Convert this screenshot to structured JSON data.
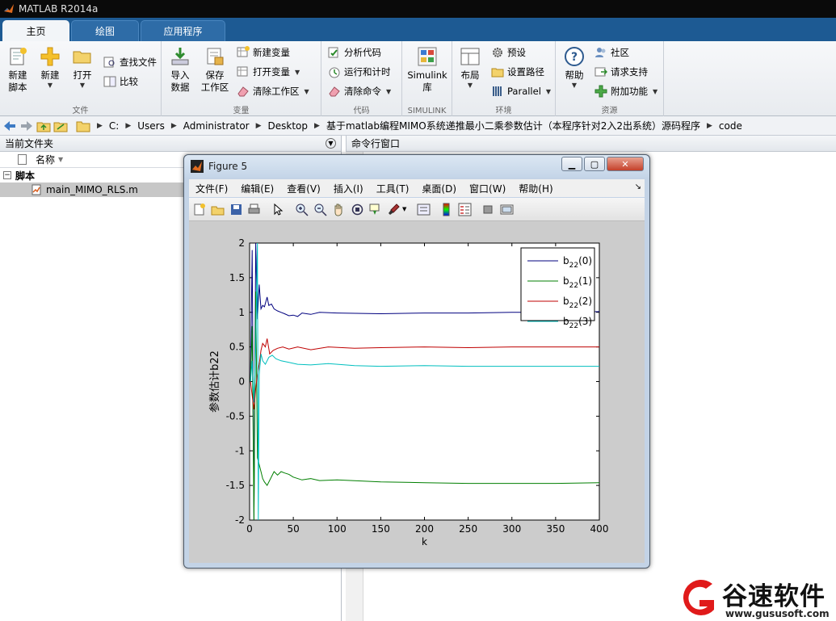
{
  "window": {
    "title": "MATLAB R2014a"
  },
  "ribbon_tabs": [
    {
      "label": "主页",
      "active": true
    },
    {
      "label": "绘图",
      "active": false
    },
    {
      "label": "应用程序",
      "active": false
    }
  ],
  "ribbon": {
    "file": {
      "group_label": "文件",
      "new_script": "新建\n脚本",
      "new": "新建",
      "open": "打开",
      "find_files": "查找文件",
      "compare": "比较"
    },
    "variable": {
      "group_label": "变量",
      "import": "导入\n数据",
      "save_ws": "保存\n工作区",
      "new_var": "新建变量",
      "open_var": "打开变量",
      "clear_ws": "清除工作区"
    },
    "code": {
      "group_label": "代码",
      "analyze": "分析代码",
      "run_time": "运行和计时",
      "clear_cmd": "清除命令"
    },
    "simulink": {
      "group_label": "SIMULINK",
      "lib": "Simulink\n库"
    },
    "env": {
      "group_label": "环境",
      "layout": "布局",
      "prefs": "预设",
      "set_path": "设置路径",
      "parallel": "Parallel"
    },
    "resources": {
      "group_label": "资源",
      "help": "帮助",
      "community": "社区",
      "support": "请求支持",
      "addons": "附加功能"
    }
  },
  "address": {
    "crumbs": [
      "C:",
      "Users",
      "Administrator",
      "Desktop",
      "基于matlab编程MIMO系统递推最小二乘参数估计（本程序针对2入2出系统）源码程序",
      "code"
    ]
  },
  "current_folder": {
    "title": "当前文件夹",
    "column_name": "名称",
    "group": "脚本",
    "file": "main_MIMO_RLS.m"
  },
  "command_window": {
    "title": "命令行窗口"
  },
  "figure": {
    "title": "Figure 5",
    "menus": [
      "文件(F)",
      "编辑(E)",
      "查看(V)",
      "插入(I)",
      "工具(T)",
      "桌面(D)",
      "窗口(W)",
      "帮助(H)"
    ]
  },
  "chart_data": {
    "type": "line",
    "xlabel": "k",
    "ylabel": "参数估计b22",
    "xlim": [
      0,
      400
    ],
    "ylim": [
      -2,
      2
    ],
    "xticks": [
      0,
      50,
      100,
      150,
      200,
      250,
      300,
      350,
      400
    ],
    "yticks": [
      -2,
      -1.5,
      -1,
      -0.5,
      0,
      0.5,
      1,
      1.5,
      2
    ],
    "legend_position": "top-right",
    "series": [
      {
        "name": "b22(0)",
        "legend_base": "b",
        "legend_sub": "22",
        "legend_arg": "(0)",
        "color": "#00007f",
        "points": [
          [
            1,
            0
          ],
          [
            3,
            1.9
          ],
          [
            5,
            -2
          ],
          [
            7,
            2
          ],
          [
            9,
            0.9
          ],
          [
            11,
            1.4
          ],
          [
            13,
            1.05
          ],
          [
            15,
            1.1
          ],
          [
            17,
            1.08
          ],
          [
            20,
            1.22
          ],
          [
            22,
            1.1
          ],
          [
            25,
            1.12
          ],
          [
            28,
            1.05
          ],
          [
            32,
            1.02
          ],
          [
            36,
            1.0
          ],
          [
            40,
            0.98
          ],
          [
            45,
            0.95
          ],
          [
            50,
            0.96
          ],
          [
            55,
            0.94
          ],
          [
            60,
            0.99
          ],
          [
            70,
            0.97
          ],
          [
            80,
            1.0
          ],
          [
            100,
            0.99
          ],
          [
            150,
            0.98
          ],
          [
            200,
            0.99
          ],
          [
            250,
            0.99
          ],
          [
            300,
            1.0
          ],
          [
            350,
            1.0
          ],
          [
            400,
            1.01
          ]
        ]
      },
      {
        "name": "b22(1)",
        "legend_base": "b",
        "legend_sub": "22",
        "legend_arg": "(1)",
        "color": "#007f00",
        "points": [
          [
            1,
            0
          ],
          [
            3,
            0.8
          ],
          [
            5,
            -2
          ],
          [
            7,
            1.3
          ],
          [
            9,
            -1.1
          ],
          [
            11,
            -1.2
          ],
          [
            13,
            -1.3
          ],
          [
            15,
            -1.4
          ],
          [
            17,
            -1.45
          ],
          [
            20,
            -1.5
          ],
          [
            24,
            -1.4
          ],
          [
            28,
            -1.3
          ],
          [
            32,
            -1.35
          ],
          [
            36,
            -1.3
          ],
          [
            40,
            -1.32
          ],
          [
            45,
            -1.34
          ],
          [
            50,
            -1.38
          ],
          [
            60,
            -1.42
          ],
          [
            70,
            -1.4
          ],
          [
            80,
            -1.43
          ],
          [
            100,
            -1.42
          ],
          [
            150,
            -1.45
          ],
          [
            200,
            -1.46
          ],
          [
            250,
            -1.47
          ],
          [
            300,
            -1.47
          ],
          [
            350,
            -1.47
          ],
          [
            400,
            -1.46
          ]
        ]
      },
      {
        "name": "b22(2)",
        "legend_base": "b",
        "legend_sub": "22",
        "legend_arg": "(2)",
        "color": "#bf0000",
        "points": [
          [
            1,
            0
          ],
          [
            3,
            -0.2
          ],
          [
            5,
            -0.4
          ],
          [
            7,
            -0.1
          ],
          [
            9,
            0.1
          ],
          [
            11,
            0.25
          ],
          [
            13,
            0.45
          ],
          [
            15,
            0.55
          ],
          [
            18,
            0.5
          ],
          [
            20,
            0.62
          ],
          [
            23,
            0.4
          ],
          [
            27,
            0.45
          ],
          [
            32,
            0.48
          ],
          [
            38,
            0.5
          ],
          [
            45,
            0.47
          ],
          [
            55,
            0.5
          ],
          [
            70,
            0.46
          ],
          [
            90,
            0.5
          ],
          [
            120,
            0.48
          ],
          [
            150,
            0.49
          ],
          [
            200,
            0.5
          ],
          [
            250,
            0.49
          ],
          [
            300,
            0.5
          ],
          [
            350,
            0.5
          ],
          [
            400,
            0.5
          ]
        ]
      },
      {
        "name": "b22(3)",
        "legend_base": "b",
        "legend_sub": "22",
        "legend_arg": "(3)",
        "color": "#00bfbf",
        "points": [
          [
            1,
            0
          ],
          [
            3,
            0.3
          ],
          [
            5,
            -0.3
          ],
          [
            7,
            0.5
          ],
          [
            9,
            2
          ],
          [
            10,
            -2
          ],
          [
            11,
            0.1
          ],
          [
            13,
            0.4
          ],
          [
            15,
            0.3
          ],
          [
            18,
            0.25
          ],
          [
            22,
            0.35
          ],
          [
            26,
            0.38
          ],
          [
            30,
            0.33
          ],
          [
            36,
            0.3
          ],
          [
            44,
            0.28
          ],
          [
            55,
            0.25
          ],
          [
            70,
            0.24
          ],
          [
            90,
            0.26
          ],
          [
            120,
            0.23
          ],
          [
            150,
            0.22
          ],
          [
            200,
            0.23
          ],
          [
            250,
            0.22
          ],
          [
            300,
            0.22
          ],
          [
            350,
            0.22
          ],
          [
            400,
            0.22
          ]
        ]
      }
    ]
  },
  "watermark": {
    "brand": "谷速软件",
    "url": "www.gususoft.com"
  }
}
